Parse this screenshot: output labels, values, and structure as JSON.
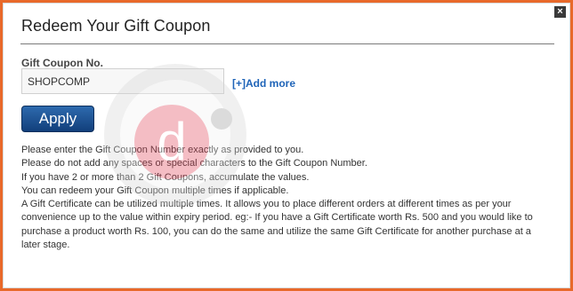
{
  "dialog": {
    "title": "Redeem Your Gift Coupon",
    "close_glyph": "×"
  },
  "form": {
    "field_label": "Gift Coupon No.",
    "coupon_value": "SHOPCOMP",
    "add_more_label": "[+]Add more",
    "apply_label": "Apply"
  },
  "info_lines": [
    "Please enter the Gift Coupon Number exactly as provided to you.",
    "Please do not add any spaces or special characters to the Gift Coupon Number.",
    "If you have 2 or more than 2 Gift Coupons, accumulate the values.",
    "You can redeem your Gift Coupon multiple times if applicable.",
    "A Gift Certificate can be utilized multiple times. It allows you to place different orders at different times as per your convenience up to the value within expiry period. eg:- If you have a Gift Certificate worth Rs. 500 and you would like to purchase a product worth Rs. 100, you can do the same and utilize the same Gift Certificate for another purchase at a later stage."
  ],
  "watermark": {
    "letter": "d",
    "icon": "logo-watermark-icon"
  },
  "colors": {
    "frame": "#e8692a",
    "link": "#1f64b8",
    "button": "#1a4a8a",
    "watermark_red": "#e0455a"
  }
}
